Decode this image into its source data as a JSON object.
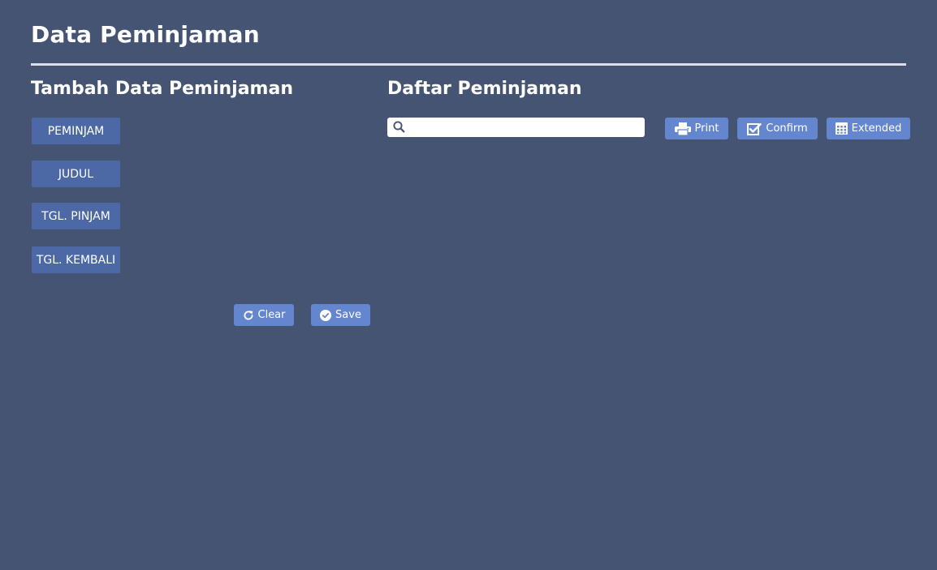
{
  "page": {
    "title": "Data Peminjaman"
  },
  "form": {
    "heading": "Tambah Data Peminjaman",
    "labels": [
      "PEMINJAM",
      "JUDUL",
      "TGL. PINJAM",
      "TGL. KEMBALI"
    ],
    "clear_label": "Clear",
    "save_label": "Save"
  },
  "list": {
    "heading": "Daftar Peminjaman",
    "search": {
      "value": "",
      "placeholder": ""
    },
    "print_label": "Print",
    "confirm_label": "Confirm",
    "extended_label": "Extended"
  },
  "colors": {
    "background": "#455473",
    "label_bg": "#4c69a6",
    "button_bg": "#6486cf",
    "divider": "#dcdfe6"
  },
  "icons": {
    "search": "search-icon",
    "clear": "refresh-icon",
    "save": "check-circle-icon",
    "print": "printer-icon",
    "confirm": "check-square-icon",
    "extended": "calendar-icon"
  }
}
